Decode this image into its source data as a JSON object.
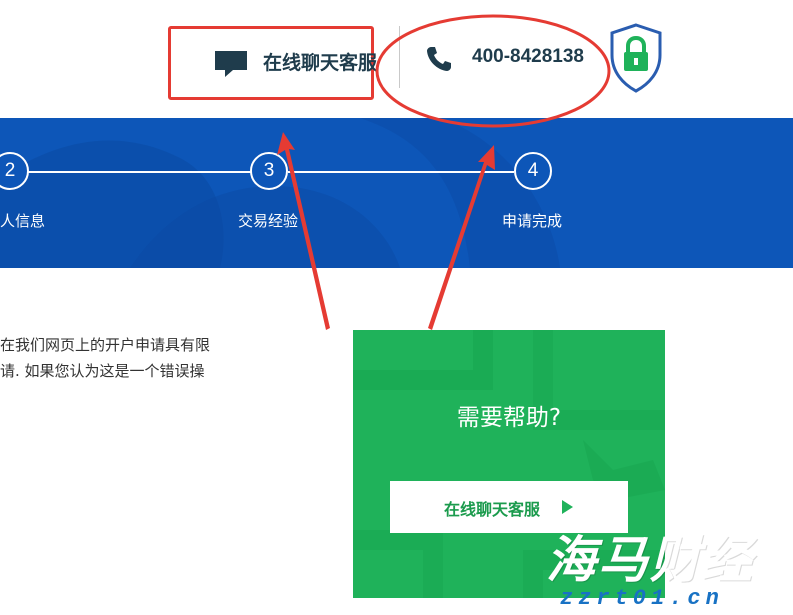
{
  "header": {
    "chat_label": "在线聊天客服",
    "phone_number": "400-8428138"
  },
  "progress": {
    "steps": [
      {
        "number": "2",
        "label": "人信息"
      },
      {
        "number": "3",
        "label": "交易经验"
      },
      {
        "number": "4",
        "label": "申请完成"
      }
    ]
  },
  "body": {
    "lines": [
      "在我们网页上的开户申请具有限",
      "请. 如果您认为这是一个错误操"
    ]
  },
  "help": {
    "title": "需要帮助?",
    "button_label": "在线聊天客服"
  },
  "watermark": {
    "title": "海马财经",
    "url": "zzrt01.cn"
  },
  "colors": {
    "band_blue": "#0d56b8",
    "help_green": "#1fb25a",
    "annotation_red": "#e53b33",
    "header_text": "#1f3c4c"
  },
  "icons": [
    "chat-bubble-icon",
    "phone-icon",
    "shield-lock-icon",
    "play-icon"
  ]
}
